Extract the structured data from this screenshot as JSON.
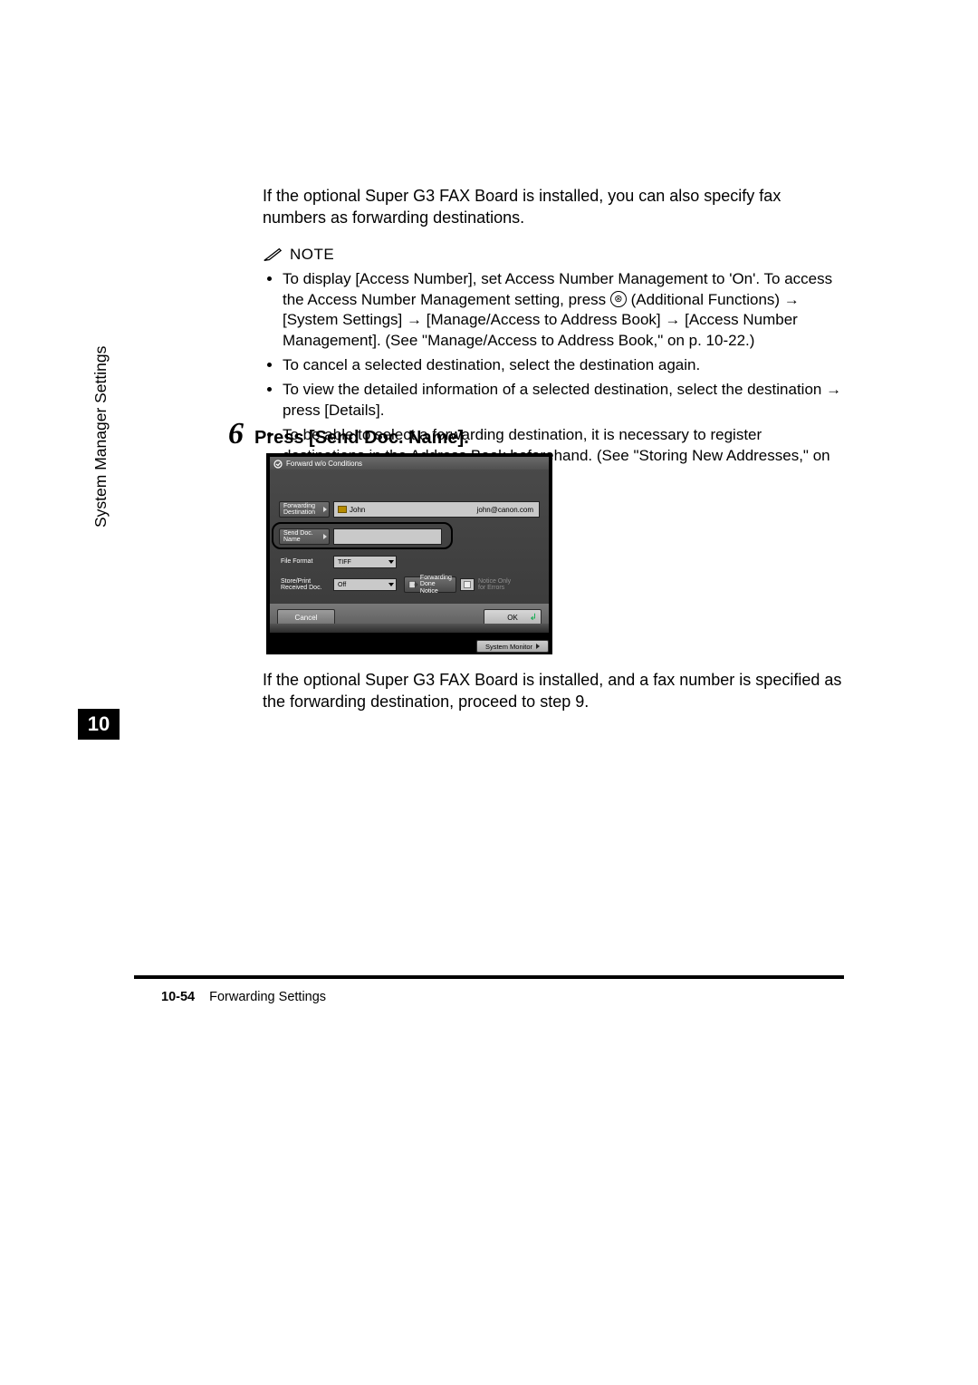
{
  "body": {
    "intro": "If the optional Super G3 FAX Board is installed, you can also specify fax numbers as forwarding destinations.",
    "note_label": "NOTE",
    "note_items": {
      "n1a": "To display [Access Number], set Access Number Management to 'On'. To access the Access Number Management setting, press ",
      "n1_icon_label": "⊛",
      "n1b": " (Additional Functions) ",
      "n1c": " [System Settings] ",
      "n1d": " [Manage/Access to Address Book] ",
      "n1e": " [Access Number Management]. (See \"Manage/Access to Address Book,\" on p. 10-22.)",
      "n2": "To cancel a selected destination, select the destination again.",
      "n3a": "To view the detailed information of a selected destination, select the destination ",
      "n3b": " press [Details].",
      "n4": "To be able to select a forwarding destination, it is necessary to register destinations in the Address Book beforehand. (See \"Storing New Addresses,\" on p. 9-5.)"
    },
    "arrow": "→",
    "step_number": "6",
    "step_text": "Press [Send Doc. Name].",
    "after_panel": "If the optional Super G3 FAX Board is installed, and a fax number is specified as the forwarding destination, proceed to step 9."
  },
  "panel": {
    "title": "Forward w/o Conditions",
    "forwarding_dest_label_a": "Forwarding",
    "forwarding_dest_label_b": "Destination",
    "forwarding_dest_value": "John",
    "forwarding_dest_right": "john@canon.com",
    "send_doc_label_a": "Send Doc.",
    "send_doc_label_b": "Name",
    "file_format_label": "File Format",
    "file_format_value": "TIFF",
    "store_print_label_a": "Store/Print",
    "store_print_label_b": "Received Doc.",
    "store_print_value": "Off",
    "fwd_done_label_a": "Forwarding",
    "fwd_done_label_b": "Done Notice",
    "notice_errors_a": "Notice Only",
    "notice_errors_b": "for Errors",
    "cancel": "Cancel",
    "ok": "OK",
    "sysmon": "System Monitor"
  },
  "sidebar": {
    "section": "System Manager Settings",
    "chapter": "10"
  },
  "footer": {
    "pagenum": "10-54",
    "title": "Forwarding Settings"
  }
}
